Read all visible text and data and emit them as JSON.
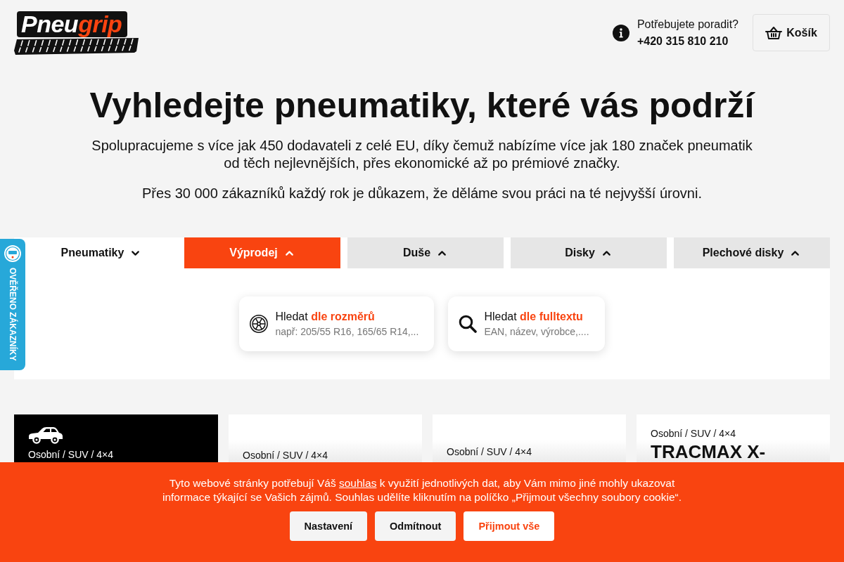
{
  "header": {
    "logo": {
      "part_1": "Pneu",
      "part_2": "grip"
    },
    "help": {
      "question": "Potřebujete poradit?",
      "phone": "+420 315 810 210"
    },
    "cart_button": {
      "label": "Košík"
    }
  },
  "hero": {
    "title": "Vyhledejte pneumatiky, které vás podrží",
    "paragraphs": [
      "Spolupracujeme s více jak 450 dodavateli z celé EU, díky čemuž nabízíme více jak 180 značek pneumatik od těch nejlevnějších, přes ekonomické až po prémiové značky.",
      "Přes 30 000 zákazníků každý rok je důkazem, že děláme svou práci na té nejvyšší úrovni."
    ]
  },
  "side_badge": {
    "label": "OVĚŘENO ZÁKAZNÍKY"
  },
  "tabs": [
    {
      "label": "Pneumatiky",
      "selected": true,
      "highlighted": false
    },
    {
      "label": "Výprodej",
      "selected": false,
      "highlighted": true
    },
    {
      "label": "Duše",
      "selected": false,
      "highlighted": false
    },
    {
      "label": "Disky",
      "selected": false,
      "highlighted": false
    },
    {
      "label": "Plechové disky",
      "selected": false,
      "highlighted": false
    }
  ],
  "search_options": [
    {
      "kind": "dimensions",
      "title": "Hledat **dle rozměrů**",
      "subtitle": "např: 205/55 R16, 165/65 R14,..."
    },
    {
      "kind": "fulltext",
      "title": "Hledat **dle fulltextu**",
      "subtitle": "EAN, název, výrobce,...."
    }
  ],
  "cards": [
    {
      "kind": "category",
      "category": "Osobní / SUV / 4×4"
    },
    {
      "kind": "product",
      "category": "Osobní / SUV / 4×4"
    },
    {
      "kind": "product",
      "category": "Osobní / SUV / 4×4"
    },
    {
      "kind": "product",
      "category": "Osobní / SUV / 4×4",
      "title": "TRACMAX X-"
    }
  ],
  "cookie_banner": {
    "text_before": "Tyto webové stránky potřebují Váš ",
    "link": "souhlas",
    "text_after": " k využití jednotlivých dat, aby Vám mimo jiné mohly ukazovat informace týkající se Vašich zájmů. Souhlas udělíte kliknutím na políčko „Přijmout všechny soubory cookie“.",
    "buttons": [
      {
        "label": "Nastavení",
        "kind": "secondary"
      },
      {
        "label": "Odmítnout",
        "kind": "secondary"
      },
      {
        "label": "Přijmout vše",
        "kind": "primary"
      }
    ]
  }
}
